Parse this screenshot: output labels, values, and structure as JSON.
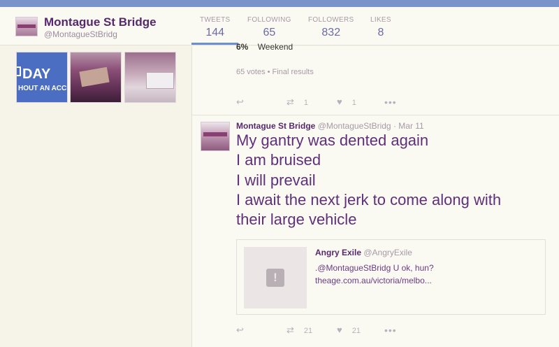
{
  "profile": {
    "name": "Montague St Bridge",
    "handle": "@MontagueStBridg"
  },
  "stats": [
    {
      "label": "TWEETS",
      "value": "144"
    },
    {
      "label": "FOLLOWING",
      "value": "65"
    },
    {
      "label": "FOLLOWERS",
      "value": "832"
    },
    {
      "label": "LIKES",
      "value": "8"
    }
  ],
  "media": {
    "tile1_main": "DAY",
    "tile1_sub": "HOUT AN ACCI"
  },
  "poll_tweet": {
    "option_pct": "6%",
    "option_label": "Weekend",
    "meta": "65 votes • Final results",
    "retweets": "1",
    "likes": "1"
  },
  "tweet": {
    "name": "Montague St Bridge",
    "handle": "@MontagueStBridg",
    "date": "· Mar 11",
    "lines": [
      "My gantry was dented again",
      "I am bruised",
      "I will prevail",
      "I await the next jerk to come along with",
      "their large vehicle"
    ],
    "retweets": "21",
    "likes": "21"
  },
  "quote": {
    "name": "Angry Exile",
    "handle": "@AngryExile",
    "line1": ".@MontagueStBridg U ok, hun?",
    "line2": "theage.com.au/victoria/melbo..."
  },
  "icons": {
    "reply": "reply-icon",
    "retweet": "retweet-icon",
    "like": "heart-icon",
    "more": "more-icon"
  },
  "colors": {
    "accent": "#6b8ed0",
    "name": "#56286c",
    "background": "#f6f4e8"
  }
}
